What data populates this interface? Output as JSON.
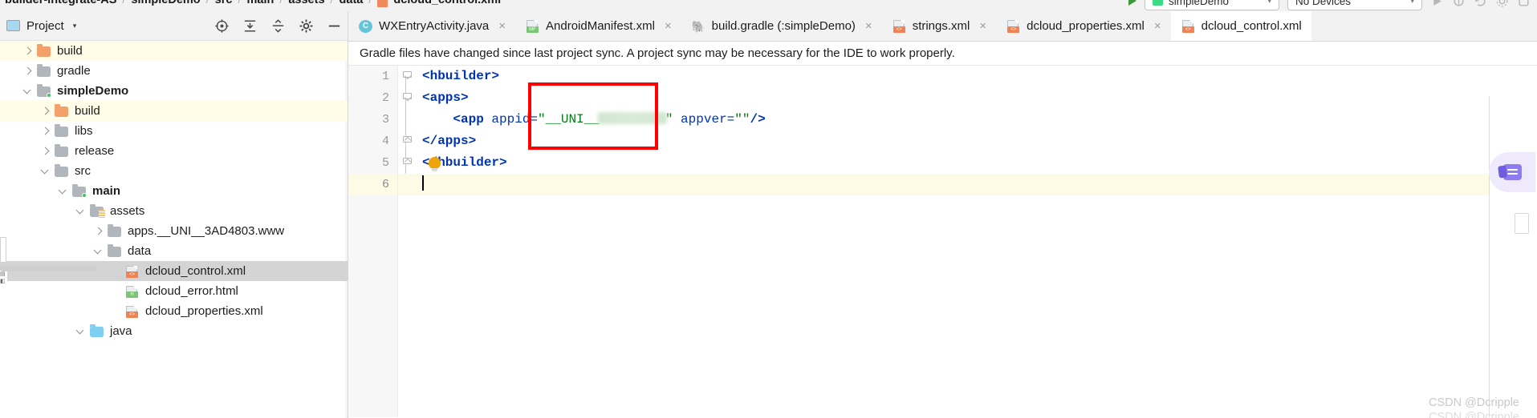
{
  "breadcrumb": {
    "items": [
      "builder-integrate-AS",
      "simpleDemo",
      "src",
      "main",
      "assets",
      "data",
      "dcloud_control.xml"
    ],
    "separator": "/",
    "file_icon": "xml-file-icon"
  },
  "toolbar": {
    "run_config": {
      "label": "simpleDemo",
      "icon": "android-app-icon",
      "caret": "▾"
    },
    "device_selector": {
      "label": "No Devices",
      "caret": "▾"
    },
    "run_button_icon": "run-play-icon",
    "icons": [
      "run-play-icon",
      "attach-debugger-icon",
      "search-everywhere-icon",
      "settings-gear-icon",
      "sdk-manager-icon"
    ]
  },
  "project_panel": {
    "title": "Project",
    "caret": "▾",
    "icons": [
      "locate-target-icon",
      "collapse-all-icon",
      "expand-all-icon",
      "settings-gear-icon",
      "hide-panel-icon"
    ]
  },
  "tree": {
    "items": [
      {
        "label": "build",
        "depth": 1,
        "arrow": "collapsed",
        "icon": "folder-orange",
        "state": "highlight"
      },
      {
        "label": "gradle",
        "depth": 1,
        "arrow": "collapsed",
        "icon": "folder-gray",
        "state": "normal"
      },
      {
        "label": "simpleDemo",
        "depth": 1,
        "arrow": "expanded",
        "icon": "folder-module",
        "state": "bold"
      },
      {
        "label": "build",
        "depth": 2,
        "arrow": "collapsed",
        "icon": "folder-orange",
        "state": "highlight"
      },
      {
        "label": "libs",
        "depth": 2,
        "arrow": "collapsed",
        "icon": "folder-gray",
        "state": "normal"
      },
      {
        "label": "release",
        "depth": 2,
        "arrow": "collapsed",
        "icon": "folder-gray",
        "state": "normal"
      },
      {
        "label": "src",
        "depth": 2,
        "arrow": "expanded",
        "icon": "folder-gray",
        "state": "normal"
      },
      {
        "label": "main",
        "depth": 3,
        "arrow": "expanded",
        "icon": "folder-module",
        "state": "bold"
      },
      {
        "label": "assets",
        "depth": 4,
        "arrow": "expanded",
        "icon": "folder-assets",
        "state": "normal"
      },
      {
        "label": "apps.__UNI__3AD4803.www",
        "depth": 5,
        "arrow": "collapsed",
        "icon": "folder-gray",
        "state": "normal"
      },
      {
        "label": "data",
        "depth": 5,
        "arrow": "expanded",
        "icon": "folder-gray",
        "state": "normal"
      },
      {
        "label": "dcloud_control.xml",
        "depth": 6,
        "arrow": "none",
        "icon": "file-xml",
        "state": "selected"
      },
      {
        "label": "dcloud_error.html",
        "depth": 6,
        "arrow": "none",
        "icon": "file-html",
        "state": "normal"
      },
      {
        "label": "dcloud_properties.xml",
        "depth": 6,
        "arrow": "none",
        "icon": "file-xml",
        "state": "normal"
      },
      {
        "label": "java",
        "depth": 4,
        "arrow": "expanded",
        "icon": "folder-blue",
        "state": "normal"
      }
    ]
  },
  "tabs": [
    {
      "label": "WXEntryActivity.java",
      "icon": "java-class-icon",
      "close": "×",
      "active": false
    },
    {
      "label": "AndroidManifest.xml",
      "icon": "manifest-file-icon",
      "close": "×",
      "active": false
    },
    {
      "label": "build.gradle (:simpleDemo)",
      "icon": "gradle-file-icon",
      "close": "×",
      "active": false
    },
    {
      "label": "strings.xml",
      "icon": "xml-file-icon",
      "close": "×",
      "active": false
    },
    {
      "label": "dcloud_properties.xml",
      "icon": "xml-file-icon",
      "close": "×",
      "active": false
    },
    {
      "label": "dcloud_control.xml",
      "icon": "xml-file-icon",
      "close": "",
      "active": true
    }
  ],
  "notification": {
    "message": "Gradle files have changed since last project sync. A project sync may be necessary for the IDE to work properly."
  },
  "editor": {
    "line_numbers": [
      "1",
      "2",
      "3",
      "4",
      "5",
      "6"
    ],
    "lines": [
      {
        "n": "1",
        "indent": 0,
        "fold": "down",
        "segments": [
          {
            "t": "<hbuilder>",
            "c": "tag"
          }
        ]
      },
      {
        "n": "2",
        "indent": 0,
        "fold": "down",
        "segments": [
          {
            "t": "<apps>",
            "c": "tag"
          }
        ]
      },
      {
        "n": "3",
        "indent": 4,
        "fold": "none",
        "segments": [
          {
            "t": "<app ",
            "c": "tag"
          },
          {
            "t": "appid=",
            "c": "attr"
          },
          {
            "t": "\"__UNI__",
            "c": "val"
          },
          {
            "t": "",
            "c": "redacted"
          },
          {
            "t": "\"",
            "c": "val"
          },
          {
            "t": " appver=",
            "c": "attr"
          },
          {
            "t": "\"\"",
            "c": "val"
          },
          {
            "t": "/>",
            "c": "tag"
          }
        ]
      },
      {
        "n": "4",
        "indent": 0,
        "fold": "up",
        "segments": [
          {
            "t": "</apps>",
            "c": "tag"
          }
        ]
      },
      {
        "n": "5",
        "indent": 0,
        "fold": "up",
        "segments": [
          {
            "t": "</hbuilder>",
            "c": "tag"
          }
        ],
        "bulb": true
      },
      {
        "n": "6",
        "indent": 0,
        "fold": "none",
        "segments": [],
        "caret": true,
        "current": true
      }
    ],
    "annotation_box": {
      "color": "#ff0000",
      "label": "appid-highlight-box"
    },
    "colors": {
      "tag": "#0033b3",
      "attribute": "#0033b3",
      "value": "#067d17",
      "current_line_bg": "#fdfae6"
    }
  },
  "assistant": {
    "icon": "ai-assistant-icon"
  },
  "watermark": {
    "text": "CSDN @Dcripple"
  }
}
